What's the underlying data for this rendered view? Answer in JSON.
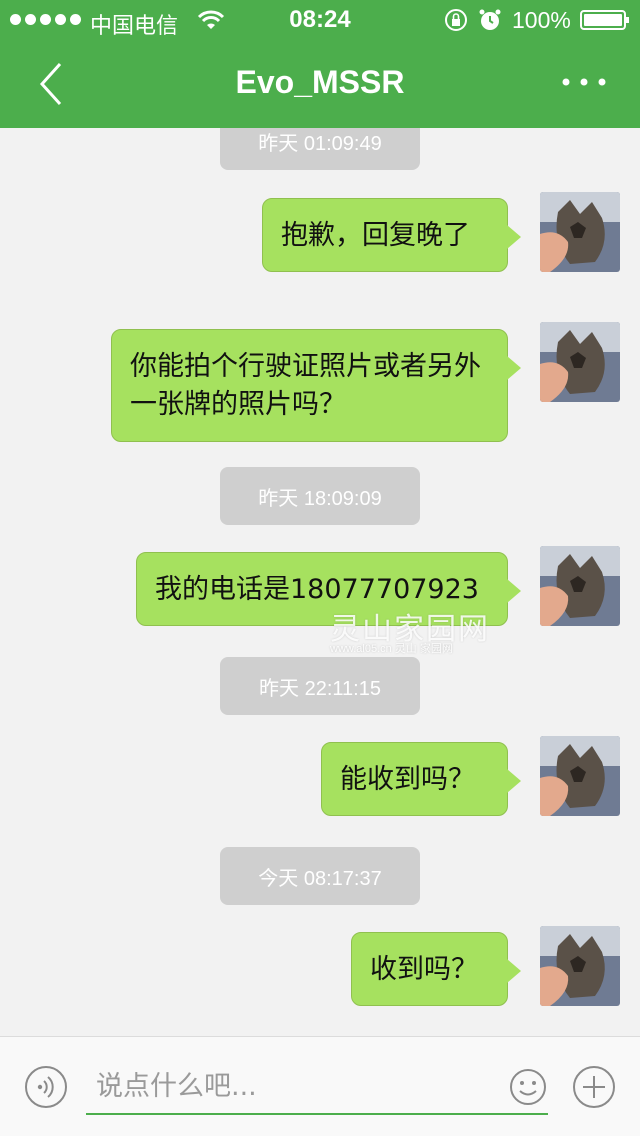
{
  "status_bar": {
    "carrier": "中国电信",
    "time": "08:24",
    "battery": "100%"
  },
  "nav": {
    "title": "Evo_MSSR"
  },
  "messages": [
    {
      "type": "timestamp",
      "text": "昨天 01:09:49"
    },
    {
      "type": "sent",
      "text": "抱歉，回复晚了"
    },
    {
      "type": "sent",
      "text": "你能拍个行驶证照片或者另外一张牌的照片吗？"
    },
    {
      "type": "timestamp",
      "text": "昨天 18:09:09"
    },
    {
      "type": "sent",
      "text": "我的电话是18077707923"
    },
    {
      "type": "timestamp",
      "text": "昨天 22:11:15"
    },
    {
      "type": "sent",
      "text": "能收到吗？"
    },
    {
      "type": "timestamp",
      "text": "今天 08:17:37"
    },
    {
      "type": "sent",
      "text": "收到吗？"
    }
  ],
  "watermark": {
    "main": "灵山家园网",
    "sub": "www.al05.cn 灵山 家园网"
  },
  "input_bar": {
    "placeholder": "说点什么吧..."
  },
  "colors": {
    "nav_green": "#4cae4c",
    "bubble_green": "#a6e15f",
    "timestamp_gray": "#cfcfcf"
  },
  "icons": [
    "back-chevron-icon",
    "more-dots-icon",
    "voice-icon",
    "emoji-icon",
    "plus-icon",
    "wifi-icon",
    "lock-rotation-icon",
    "alarm-icon",
    "battery-icon"
  ]
}
